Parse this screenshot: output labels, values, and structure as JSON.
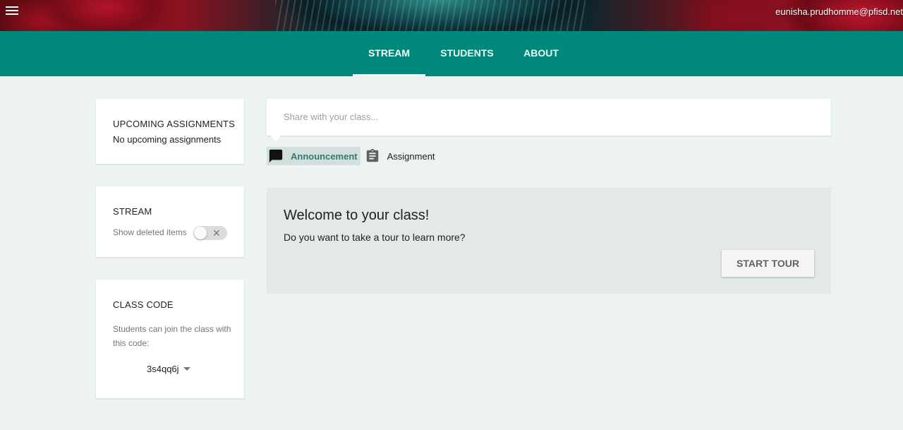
{
  "header": {
    "user_email": "eunisha.prudhomme@pfisd.net"
  },
  "tabs": [
    {
      "label": "STREAM",
      "active": true
    },
    {
      "label": "STUDENTS",
      "active": false
    },
    {
      "label": "ABOUT",
      "active": false
    }
  ],
  "colors": {
    "accent": "#00897b",
    "background": "#ecf3f2",
    "welcome_bg": "#e3e9e8"
  },
  "sidebar": {
    "upcoming": {
      "title": "UPCOMING ASSIGNMENTS",
      "empty_text": "No upcoming assignments"
    },
    "stream": {
      "title": "STREAM",
      "toggle_label": "Show deleted items",
      "toggle_on": false
    },
    "class_code": {
      "title": "CLASS CODE",
      "description": "Students can join the class with this code:",
      "code": "3s4qq6j"
    }
  },
  "main": {
    "share_placeholder": "Share with your class...",
    "post_types": [
      {
        "label": "Announcement",
        "icon": "announcement-icon",
        "active": true
      },
      {
        "label": "Assignment",
        "icon": "assignment-icon",
        "active": false
      }
    ],
    "welcome": {
      "title": "Welcome to your class!",
      "question": "Do you want to take a tour to learn more?",
      "button": "START TOUR"
    }
  }
}
